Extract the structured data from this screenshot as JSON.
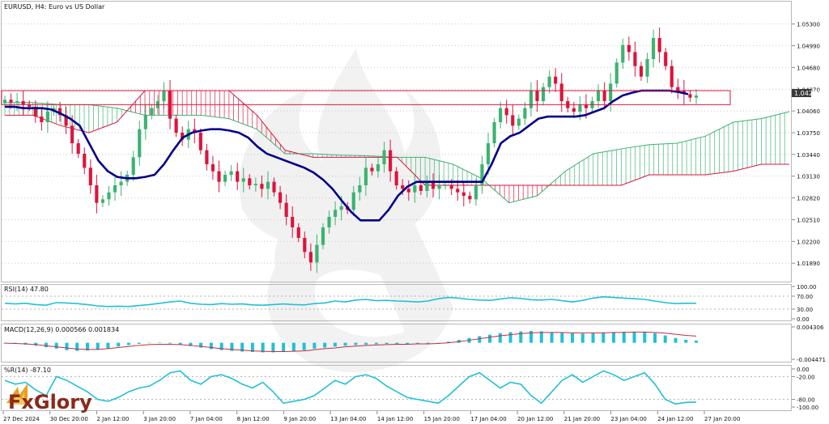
{
  "header": {
    "symbol": "EURUSD, H4:",
    "description": "Euro vs US Dollar"
  },
  "watermark": {
    "brand": "FxGlory"
  },
  "colors": {
    "bull": "#3cb371",
    "bear": "#dc143c",
    "kijun": "#00008b",
    "cloud_up_fill": "#3cb371",
    "cloud_down_fill": "#dc143c",
    "oscillator": "#20c0d8",
    "signal": "#c0303a",
    "grid": "#c8c8c8",
    "box": "#dc143c"
  },
  "chart_data": [
    {
      "type": "candlestick",
      "symbol": "EURUSD",
      "timeframe": "H4",
      "title": "EURUSD, H4: Euro vs US Dollar",
      "ylim": [
        1.0165,
        1.0555
      ],
      "y_ticks": [
        "1.05300",
        "1.04990",
        "1.04680",
        "1.04370",
        "1.04060",
        "1.03750",
        "1.03440",
        "1.03130",
        "1.02820",
        "1.02510",
        "1.02200",
        "1.01890"
      ],
      "current_price": "1.04283",
      "x_ticks": [
        "27 Dec 2024",
        "30 Dec 20:00",
        "2 Jan 12:00",
        "3 Jan 20:00",
        "7 Jan 04:00",
        "8 Jan 12:00",
        "9 Jan 20:00",
        "13 Jan 04:00",
        "14 Jan 12:00",
        "15 Jan 20:00",
        "17 Jan 04:00",
        "20 Jan 12:00",
        "21 Jan 20:00",
        "23 Jan 04:00",
        "24 Jan 12:00",
        "27 Jan 20:00"
      ],
      "closes": [
        1.0422,
        1.0418,
        1.042,
        1.0415,
        1.0412,
        1.0398,
        1.039,
        1.0405,
        1.041,
        1.04,
        1.0385,
        1.036,
        1.0345,
        1.0325,
        1.03,
        1.0275,
        1.028,
        1.029,
        1.03,
        1.0305,
        1.0315,
        1.034,
        1.038,
        1.04,
        1.041,
        1.042,
        1.0435,
        1.0395,
        1.0375,
        1.0365,
        1.038,
        1.0375,
        1.035,
        1.033,
        1.032,
        1.0305,
        1.0315,
        1.032,
        1.0305,
        1.031,
        1.03,
        1.0302,
        1.0295,
        1.0305,
        1.029,
        1.0275,
        1.0255,
        1.024,
        1.0225,
        1.0205,
        1.019,
        1.0215,
        1.024,
        1.0255,
        1.0265,
        1.027,
        1.0265,
        1.029,
        1.03,
        1.0325,
        1.032,
        1.033,
        1.035,
        1.032,
        1.03,
        1.0295,
        1.029,
        1.03,
        1.0292,
        1.0305,
        1.0295,
        1.03,
        1.03,
        1.0295,
        1.029,
        1.0285,
        1.028,
        1.03,
        1.033,
        1.036,
        1.039,
        1.041,
        1.04,
        1.0385,
        1.0395,
        1.041,
        1.0435,
        1.042,
        1.044,
        1.0455,
        1.0445,
        1.042,
        1.041,
        1.0405,
        1.0415,
        1.041,
        1.042,
        1.0435,
        1.042,
        1.0445,
        1.0475,
        1.05,
        1.049,
        1.047,
        1.0455,
        1.048,
        1.051,
        1.049,
        1.047,
        1.044,
        1.0435,
        1.043,
        1.0425,
        1.0428
      ],
      "kijun_sen": [
        1.0412,
        1.0412,
        1.041,
        1.041,
        1.041,
        1.0408,
        1.0402,
        1.0395,
        1.0385,
        1.036,
        1.0335,
        1.032,
        1.0312,
        1.031,
        1.031,
        1.0312,
        1.0315,
        1.033,
        1.035,
        1.0368,
        1.0375,
        1.0378,
        1.038,
        1.038,
        1.0378,
        1.0375,
        1.0368,
        1.0355,
        1.0345,
        1.034,
        1.0335,
        1.033,
        1.0325,
        1.0318,
        1.0308,
        1.0295,
        1.0278,
        1.0262,
        1.025,
        1.025,
        1.025,
        1.0265,
        1.0285,
        1.0298,
        1.0305,
        1.0305,
        1.0305,
        1.0305,
        1.0305,
        1.0305,
        1.0305,
        1.0305,
        1.033,
        1.036,
        1.037,
        1.0375,
        1.0385,
        1.0395,
        1.0398,
        1.0398,
        1.0398,
        1.0398,
        1.04,
        1.0405,
        1.041,
        1.042,
        1.0428,
        1.0432,
        1.0435,
        1.0435,
        1.0435,
        1.0435,
        1.0433,
        1.043
      ],
      "ichimoku_cloud": {
        "senkou_span_a": [
          1.0418,
          1.0418,
          1.0415,
          1.0415,
          1.041,
          1.04,
          1.04,
          1.04,
          1.0395,
          1.038,
          1.0345,
          1.0345,
          1.0343,
          1.0342,
          1.034,
          1.034,
          1.033,
          1.031,
          1.0275,
          1.0285,
          1.032,
          1.0345,
          1.0352,
          1.0358,
          1.036,
          1.037,
          1.039,
          1.0395,
          1.0405
        ],
        "senkou_span_b": [
          1.04,
          1.04,
          1.0385,
          1.0375,
          1.039,
          1.0435,
          1.0435,
          1.0435,
          1.0435,
          1.04,
          1.035,
          1.034,
          1.034,
          1.034,
          1.034,
          1.03,
          1.03,
          1.03,
          1.03,
          1.03,
          1.03,
          1.03,
          1.03,
          1.0315,
          1.0315,
          1.0315,
          1.032,
          1.033,
          1.033
        ]
      },
      "resistance_box": {
        "from": 1.0415,
        "to": 1.0435
      }
    },
    {
      "type": "line",
      "indicator": "RSI",
      "label": "RSI(14) 47.80",
      "ylim": [
        0,
        100
      ],
      "y_ticks": [
        "100.00",
        "70.00",
        "30.00",
        "0.00"
      ],
      "values": [
        48,
        46,
        48,
        44,
        42,
        50,
        49,
        47,
        44,
        40,
        38,
        39,
        38,
        41,
        44,
        48,
        52,
        55,
        48,
        45,
        44,
        47,
        45,
        46,
        43,
        42,
        44,
        46,
        44,
        43,
        47,
        49,
        55,
        52,
        58,
        60,
        56,
        57,
        55,
        54,
        52,
        55,
        62,
        66,
        64,
        60,
        58,
        57,
        61,
        65,
        63,
        59,
        58,
        60,
        56,
        52,
        57,
        64,
        68,
        66,
        64,
        62,
        60,
        55,
        50,
        47,
        48,
        48
      ]
    },
    {
      "type": "bar",
      "indicator": "MACD",
      "label": "MACD(12,26,9) 0.000566 0.001834",
      "ylim": [
        -0.004471,
        0.004306
      ],
      "y_ticks": [
        "0.004306",
        "-0.004471"
      ],
      "histogram": [
        -0.0002,
        -0.0003,
        -0.0005,
        -0.0008,
        -0.0012,
        -0.0016,
        -0.002,
        -0.0022,
        -0.0021,
        -0.0019,
        -0.0015,
        -0.001,
        -0.0006,
        -0.0003,
        0.0,
        0.0001,
        -0.0002,
        -0.0005,
        -0.0009,
        -0.0013,
        -0.0017,
        -0.002,
        -0.0022,
        -0.0024,
        -0.0025,
        -0.0026,
        -0.0026,
        -0.0025,
        -0.0023,
        -0.002,
        -0.0016,
        -0.0013,
        -0.001,
        -0.0008,
        -0.0006,
        -0.0005,
        -0.0004,
        -0.0003,
        -0.0003,
        -0.0003,
        -0.0002,
        -0.0002,
        -0.0001,
        0.0003,
        0.0008,
        0.0013,
        0.0018,
        0.0022,
        0.0026,
        0.0029,
        0.0031,
        0.0032,
        0.0031,
        0.0029,
        0.0027,
        0.0026,
        0.0025,
        0.0026,
        0.0028,
        0.0029,
        0.003,
        0.003,
        0.0029,
        0.0026,
        0.002,
        0.0013,
        0.0008,
        0.0006
      ],
      "signal": [
        -0.0001,
        -0.0002,
        -0.0003,
        -0.0005,
        -0.0008,
        -0.0011,
        -0.0014,
        -0.0017,
        -0.0018,
        -0.0018,
        -0.0016,
        -0.0013,
        -0.001,
        -0.0007,
        -0.0005,
        -0.0004,
        -0.0004,
        -0.0005,
        -0.0007,
        -0.001,
        -0.0013,
        -0.0016,
        -0.0018,
        -0.002,
        -0.0022,
        -0.0023,
        -0.0024,
        -0.0024,
        -0.0023,
        -0.0022,
        -0.0019,
        -0.0016,
        -0.0014,
        -0.0011,
        -0.0009,
        -0.0007,
        -0.0006,
        -0.0005,
        -0.0004,
        -0.0004,
        -0.0003,
        -0.0003,
        -0.0002,
        0.0,
        0.0003,
        0.0007,
        0.0011,
        0.0015,
        0.0019,
        0.0022,
        0.0025,
        0.0027,
        0.0028,
        0.0028,
        0.0028,
        0.0027,
        0.0027,
        0.0027,
        0.0027,
        0.0028,
        0.0028,
        0.0029,
        0.0029,
        0.0028,
        0.0026,
        0.0023,
        0.002,
        0.0018
      ]
    },
    {
      "type": "line",
      "indicator": "Williams %R",
      "label": "%R(14) -87.10",
      "ylim": [
        -100,
        0
      ],
      "y_ticks": [
        "0.00",
        "-20.00",
        "-80.00",
        "-100.00"
      ],
      "values": [
        -30,
        -40,
        -35,
        -55,
        -70,
        -20,
        -30,
        -45,
        -60,
        -80,
        -85,
        -75,
        -60,
        -50,
        -45,
        -30,
        -10,
        -5,
        -30,
        -40,
        -20,
        -15,
        -25,
        -40,
        -50,
        -35,
        -60,
        -90,
        -85,
        -80,
        -70,
        -50,
        -30,
        -40,
        -20,
        -15,
        -25,
        -45,
        -60,
        -75,
        -80,
        -85,
        -90,
        -70,
        -45,
        -20,
        -10,
        -30,
        -50,
        -35,
        -40,
        -70,
        -90,
        -60,
        -30,
        -15,
        -35,
        -20,
        -5,
        -15,
        -30,
        -20,
        -10,
        -40,
        -80,
        -92,
        -88,
        -87
      ]
    }
  ]
}
